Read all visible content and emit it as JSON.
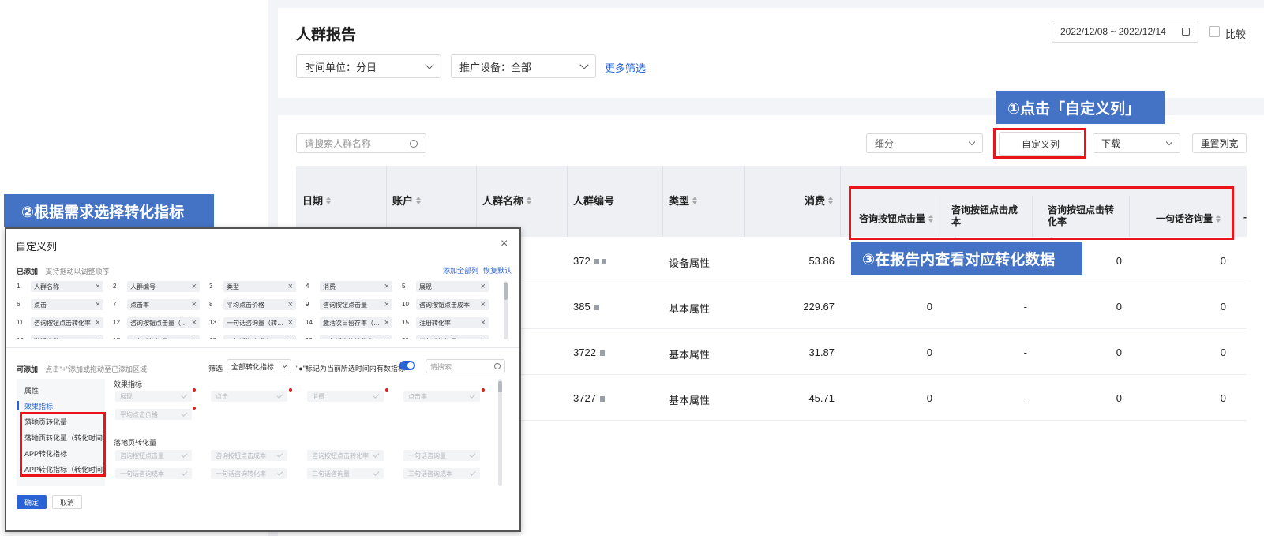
{
  "report": {
    "title": "人群报告",
    "date_range": "2022/12/08 ~ 2022/12/14",
    "compare_label": "比较",
    "filters": {
      "time_unit": "时间单位：分日",
      "device": "推广设备：全部",
      "more": "更多筛选"
    },
    "search_placeholder": "请搜索人群名称",
    "toolbar": {
      "breakdown": "细分",
      "custom_columns": "自定义列",
      "download": "下载",
      "reset_width": "重置列宽"
    },
    "columns": {
      "date": "日期",
      "account": "账户",
      "crowd_name": "人群名称",
      "crowd_id": "人群编号",
      "type": "类型",
      "cost": "消费",
      "consult_clicks": "咨询按钮点击量",
      "consult_cost_a": "咨询按钮点击成",
      "consult_cost_b": "本",
      "consult_rate_a": "咨询按钮点击转",
      "consult_rate_b": "化率",
      "one_sentence": "一句话咨询量",
      "more": "-"
    },
    "rows": [
      {
        "crowd_id": "372",
        "type": "设备属性",
        "cost": "53.86",
        "consult_clicks": "",
        "consult_cost": "",
        "consult_rate": "0",
        "one_sentence": "0"
      },
      {
        "crowd_id": "385",
        "type": "基本属性",
        "cost": "229.67",
        "consult_clicks": "0",
        "consult_cost": "-",
        "consult_rate": "0",
        "one_sentence": "0"
      },
      {
        "crowd_id": "3722",
        "type": "基本属性",
        "cost": "31.87",
        "consult_clicks": "0",
        "consult_cost": "-",
        "consult_rate": "0",
        "one_sentence": "0"
      },
      {
        "crowd_id": "3727",
        "type": "基本属性",
        "cost": "45.71",
        "consult_clicks": "0",
        "consult_cost": "-",
        "consult_rate": "0",
        "one_sentence": "0"
      }
    ]
  },
  "callouts": {
    "step1": "①点击「自定义列」",
    "step2": "②根据需求选择转化指标",
    "step3": "③在报告内查看对应转化数据"
  },
  "dialog": {
    "title": "自定义列",
    "added_label": "已添加",
    "added_hint": "支持拖动以调整顺序",
    "add_all": "添加全部列",
    "restore_default": "恢复默认",
    "added_items": [
      {
        "num": "1",
        "label": "人群名称"
      },
      {
        "num": "2",
        "label": "人群编号"
      },
      {
        "num": "3",
        "label": "类型"
      },
      {
        "num": "4",
        "label": "消费"
      },
      {
        "num": "5",
        "label": "展现"
      },
      {
        "num": "6",
        "label": "点击"
      },
      {
        "num": "7",
        "label": "点击率"
      },
      {
        "num": "8",
        "label": "平均点击价格"
      },
      {
        "num": "9",
        "label": "咨询按钮点击量"
      },
      {
        "num": "10",
        "label": "咨询按钮点击成本"
      },
      {
        "num": "11",
        "label": "咨询按钮点击转化率"
      },
      {
        "num": "12",
        "label": "咨询按钮点击量（转化..."
      },
      {
        "num": "13",
        "label": "一句话咨询量（转化时..."
      },
      {
        "num": "14",
        "label": "激活次日留存率（转化..."
      },
      {
        "num": "15",
        "label": "注册转化率"
      },
      {
        "num": "16",
        "label": "激活人数"
      },
      {
        "num": "17",
        "label": "一句话咨询量"
      },
      {
        "num": "18",
        "label": "一句话咨询成本"
      },
      {
        "num": "19",
        "label": "一句话咨询转化率"
      },
      {
        "num": "20",
        "label": "三句话咨询量"
      }
    ],
    "available_label": "可添加",
    "available_hint": "点击\"+\"添加或拖动至已添加区域",
    "filter_label": "筛选",
    "filter_value": "全部转化指标",
    "marker_note": "\"●\"标记为当前所选时间内有数指标",
    "search_placeholder": "请搜索",
    "categories": [
      "属性",
      "效果指标",
      "落地页转化量",
      "落地页转化量（转化时间）",
      "APP转化指标",
      "APP转化指标（转化时间）"
    ],
    "effect_section": "效果指标",
    "effect_items": [
      "展现",
      "点击",
      "消费",
      "点击率",
      "平均点击价格"
    ],
    "landing_section": "落地页转化量",
    "landing_items": [
      "咨询按钮点击量",
      "咨询按钮点击成本",
      "咨询按钮点击转化率",
      "一句话咨询量",
      "一句话咨询成本",
      "一句话咨询转化率",
      "三句话咨询量",
      "三句话咨询成本"
    ],
    "ok": "确定",
    "cancel": "取消"
  },
  "colors": {
    "accent": "#2a63d6",
    "callout": "#4472c4",
    "highlight": "#e8141a"
  }
}
